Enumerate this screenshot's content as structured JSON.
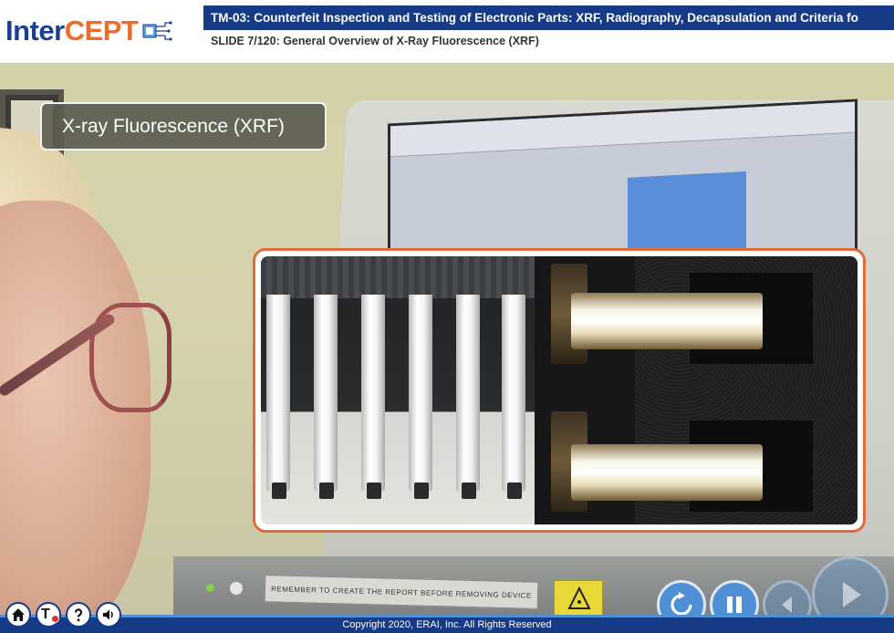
{
  "header": {
    "logo_part1": "Inter",
    "logo_part2": "CEPT",
    "course_title": "TM-03: Counterfeit Inspection and Testing of Electronic Parts: XRF, Radiography, Decapsulation and Criteria fo",
    "slide_title": "SLIDE 7/120: General Overview of X-Ray Fluorescence (XRF)"
  },
  "slide": {
    "callout_text": "X-ray Fluorescence (XRF)",
    "device_label": "REMEMBER TO CREATE THE REPORT BEFORE REMOVING DEVICE"
  },
  "footer": {
    "copyright": "Copyright 2020, ERAI, Inc. All Rights Reserved",
    "toc_label": "T"
  },
  "icons": {
    "home": "home-icon",
    "toc": "table-of-contents-icon",
    "help": "help-icon",
    "audio": "speaker-icon",
    "replay": "replay-icon",
    "pause": "pause-icon",
    "prev": "previous-icon",
    "next": "next-icon"
  },
  "colors": {
    "brand_blue": "#173a86",
    "brand_orange": "#ee6b2a",
    "nav_blue": "#4f8fd6",
    "inset_border": "#e06a3c"
  }
}
